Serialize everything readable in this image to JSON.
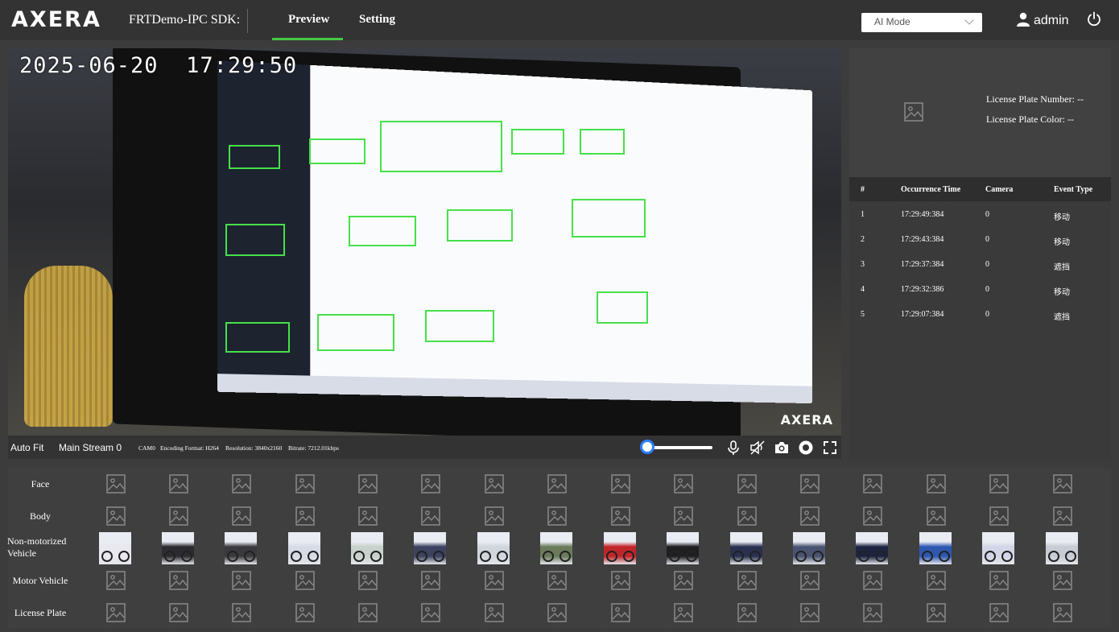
{
  "header": {
    "logo": "AXERA",
    "app_title": "FRTDemo-IPC SDK:",
    "tabs": [
      {
        "label": "Preview",
        "active": true
      },
      {
        "label": "Setting",
        "active": false
      }
    ],
    "mode_select": {
      "value": "AI Mode"
    },
    "user": "admin",
    "accent_color": "#46c846"
  },
  "video": {
    "timestamp": "2025-06-20  17:29:50",
    "watermark": "AXERA",
    "controls": {
      "auto_fit": "Auto Fit",
      "stream": "Main Stream 0",
      "camera": "CAM0",
      "encoding": "Encoding Format: H264",
      "resolution": "Resolution: 3840x2160",
      "bitrate": "Bitrate: 7212.01kbps",
      "volume": 0
    },
    "icons": [
      "mic-icon",
      "speaker-muted-icon",
      "camera-icon",
      "record-icon",
      "fullscreen-icon"
    ]
  },
  "plate": {
    "number": "License Plate Number: --",
    "color": "License Plate Color: --"
  },
  "events": {
    "headers": [
      "#",
      "Occurrence Time",
      "Camera",
      "Event Type"
    ],
    "rows": [
      {
        "n": "1",
        "time": "17:29:49:384",
        "camera": "0",
        "type": "移动"
      },
      {
        "n": "2",
        "time": "17:29:43:384",
        "camera": "0",
        "type": "移动"
      },
      {
        "n": "3",
        "time": "17:29:37:384",
        "camera": "0",
        "type": "遮挡"
      },
      {
        "n": "4",
        "time": "17:29:32:386",
        "camera": "0",
        "type": "移动"
      },
      {
        "n": "5",
        "time": "17:29:07:384",
        "camera": "0",
        "type": "遮挡"
      }
    ]
  },
  "capture_rows": [
    {
      "label": "Face",
      "kind": "placeholder"
    },
    {
      "label": "Body",
      "kind": "placeholder"
    },
    {
      "label": "Non-motorized Vehicle",
      "kind": "thumbnails",
      "colors": [
        "#e8e8ee",
        "#2c2c30",
        "#3a3a3e",
        "#d7dbe6",
        "#c8d2cc",
        "#3c4260",
        "#d0d6dc",
        "#6c7a5c",
        "#c0252a",
        "#1f1f22",
        "#2a3050",
        "#4a5470",
        "#1c2440",
        "#2e58b0",
        "#d2d6e6",
        "#c8ccd4"
      ]
    },
    {
      "label": "Motor Vehicle",
      "kind": "placeholder"
    },
    {
      "label": "License Plate",
      "kind": "placeholder"
    }
  ]
}
